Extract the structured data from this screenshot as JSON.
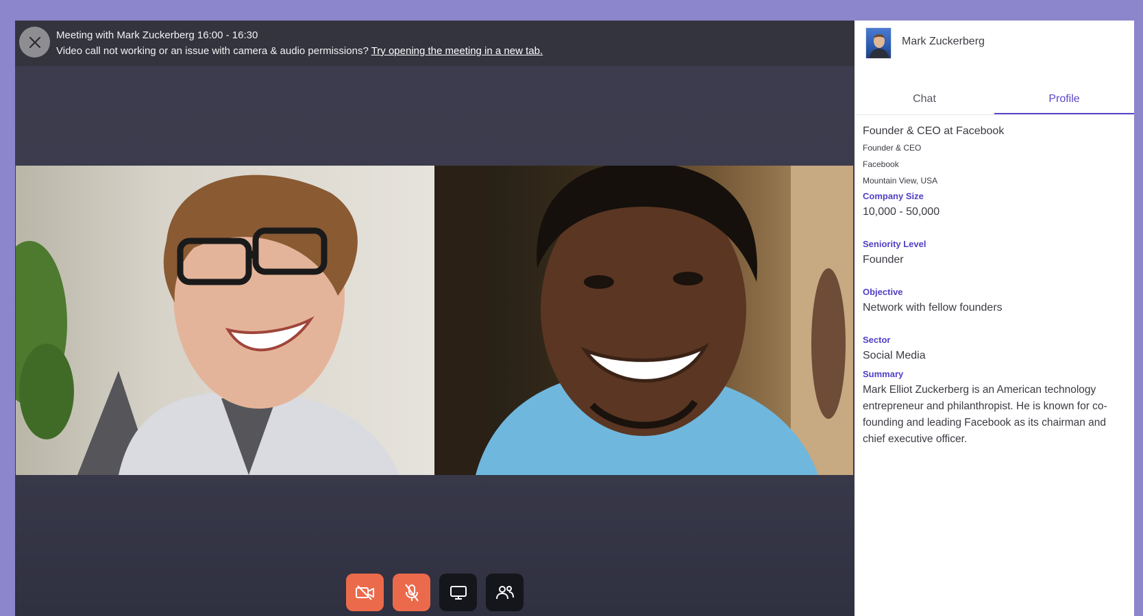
{
  "meeting": {
    "title": "Meeting with Mark Zuckerberg 16:00 - 16:30",
    "issue_text": "Video call not working or an issue with camera & audio permissions? ",
    "issue_link": "Try opening the meeting in a new tab."
  },
  "controls": {
    "camera": "camera-off-icon",
    "mic": "mic-off-icon",
    "screen_share": "screen-share-icon",
    "participants": "participants-icon"
  },
  "colors": {
    "page_background": "#8c86cc",
    "accent": "#5b45c9",
    "control_red": "#ec6a4c",
    "control_dark": "#15151c"
  },
  "panel": {
    "name": "Mark Zuckerberg",
    "tabs": [
      {
        "label": "Chat",
        "active": false
      },
      {
        "label": "Profile",
        "active": true
      }
    ]
  },
  "profile": {
    "headline": "Founder & CEO at Facebook",
    "role": "Founder & CEO",
    "company": "Facebook",
    "location": "Mountain View, USA",
    "company_size_label": "Company Size",
    "company_size": "10,000 - 50,000",
    "seniority_label": "Seniority Level",
    "seniority": "Founder",
    "objective_label": "Objective",
    "objective": "Network with fellow founders",
    "sector_label": "Sector",
    "sector": "Social Media",
    "summary_label": "Summary",
    "summary": "Mark Elliot Zuckerberg is an American technology entrepreneur and philanthropist. He is known for co-founding and leading Facebook as its chairman and chief executive officer."
  }
}
